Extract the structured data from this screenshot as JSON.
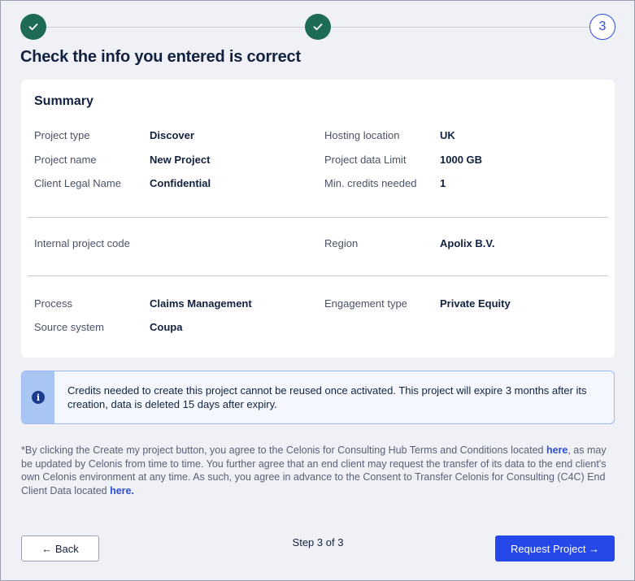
{
  "stepper": {
    "steps": [
      {
        "state": "done",
        "icon": "check-icon"
      },
      {
        "state": "done",
        "icon": "check-icon"
      },
      {
        "state": "current",
        "label": "3"
      }
    ],
    "done_color": "#1d6b54",
    "current_color": "#2d4fd8"
  },
  "page": {
    "title": "Check the info you entered is correct"
  },
  "summary": {
    "title": "Summary",
    "group1_left": [
      {
        "label": "Project type",
        "value": "Discover"
      },
      {
        "label": "Project name",
        "value": "New Project"
      },
      {
        "label": "Client Legal Name",
        "value": "Confidential"
      }
    ],
    "group1_right": [
      {
        "label": "Hosting location",
        "value": "UK"
      },
      {
        "label": "Project data Limit",
        "value": "1000 GB"
      },
      {
        "label": "Min. credits needed",
        "value": "1"
      }
    ],
    "group2_left": [
      {
        "label": "Internal project code",
        "value": ""
      }
    ],
    "group2_right": [
      {
        "label": "Region",
        "value": "Apolix B.V."
      }
    ],
    "group3_left": [
      {
        "label": "Process",
        "value": "Claims Management"
      },
      {
        "label": "Source system",
        "value": "Coupa"
      }
    ],
    "group3_right": [
      {
        "label": "Engagement type",
        "value": "Private Equity"
      }
    ]
  },
  "info": {
    "icon": "info-icon",
    "text": "Credits needed to create this project cannot be reused once activated. This project will expire 3 months after its creation, data is deleted 15 days after expiry."
  },
  "terms": {
    "part1": "*By clicking the Create my project button, you agree to the Celonis for Consulting Hub Terms and Conditions located ",
    "link1": "here",
    "part2": ", as may be updated by Celonis from time to time. You further agree that an end client may request the transfer of its data to the end client's own Celonis environment at any time. As such, you agree in advance to the Consent to Transfer Celonis for Consulting (C4C) End Client Data located ",
    "link2": "here."
  },
  "footer": {
    "back_label": "← Back",
    "step_counter": "Step 3 of 3",
    "request_label": "Request Project →",
    "accent_color": "#2748e8"
  }
}
